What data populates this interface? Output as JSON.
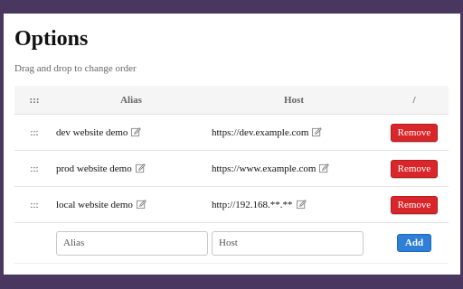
{
  "page": {
    "title": "Options",
    "hint": "Drag and drop to change order"
  },
  "table": {
    "headers": {
      "drag": ":::",
      "alias": "Alias",
      "host": "Host",
      "action": "/"
    },
    "rows": [
      {
        "drag": ":::",
        "alias": "dev website demo",
        "host": "https://dev.example.com",
        "remove_label": "Remove"
      },
      {
        "drag": ":::",
        "alias": "prod website demo",
        "host": "https://www.example.com",
        "remove_label": "Remove"
      },
      {
        "drag": ":::",
        "alias": "local website demo",
        "host": "http://192.168.**.**",
        "remove_label": "Remove"
      }
    ],
    "new_entry": {
      "alias_placeholder": "Alias",
      "host_placeholder": "Host",
      "add_label": "Add"
    }
  },
  "colors": {
    "frame_background": "#4a3760",
    "remove_button": "#d9262a",
    "add_button": "#2f7fd6"
  },
  "icons": {
    "edit": "edit-icon"
  }
}
